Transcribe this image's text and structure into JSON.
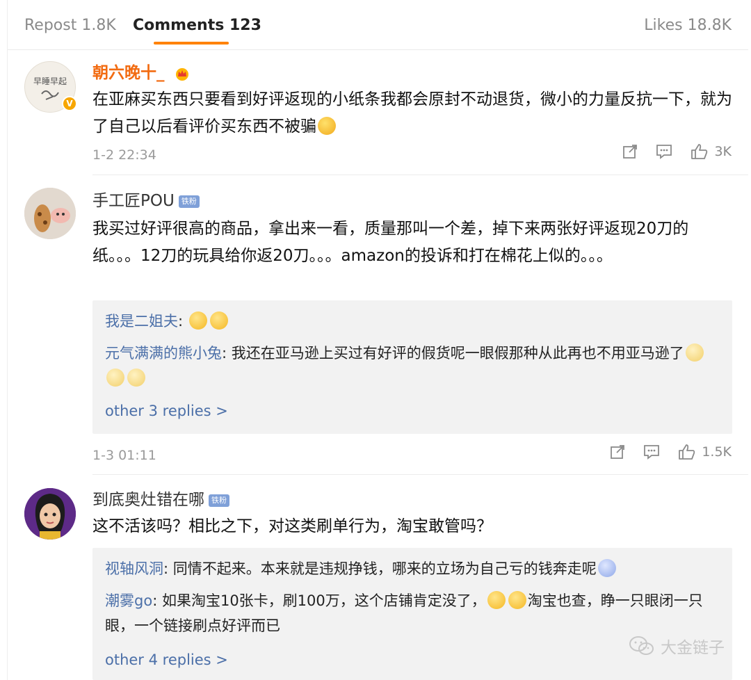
{
  "tabs": {
    "repost": "Repost 1.8K",
    "comments": "Comments 123",
    "likes": "Likes 18.8K"
  },
  "comments": [
    {
      "username": "朝六晚十_",
      "text": "在亚麻买东西只要看到好评返现的小纸条我都会原封不动退货，微小的力量反抗一下，就为了自己以后看评价买东西不被骗",
      "time": "1-2 22:34",
      "likes": "3K",
      "avatar_text": "早睡早起",
      "verified_badge": "V"
    },
    {
      "username": "手工匠POU",
      "fan_badge": "铁粉",
      "text": "我买过好评很高的商品，拿出来一看，质量那叫一个差，掉下来两张好评返现20刀的纸。。。12刀的玩具给你返20刀。。。amazon的投诉和打在棉花上似的。。。",
      "replies": [
        {
          "name": "我是二姐夫",
          "text": ""
        },
        {
          "name": "元气满满的熊小兔",
          "text": "我还在亚马逊上买过有好评的假货呢一眼假那种从此再也不用亚马逊了"
        }
      ],
      "more_replies": "other 3 replies >",
      "time": "1-3 01:11",
      "likes": "1.5K"
    },
    {
      "username": "到底奥灶错在哪",
      "fan_badge": "铁粉",
      "text": "这不活该吗？相比之下，对这类刷单行为，淘宝敢管吗？",
      "replies": [
        {
          "name": "视轴风洞",
          "text": "同情不起来。本来就是违规挣钱，哪来的立场为自己亏的钱奔走呢"
        },
        {
          "name": "潮雾go",
          "text_a": "如果淘宝10张卡，刷100万，这个店铺肯定没了，",
          "text_b": "淘宝也查，睁一只眼闭一只眼，一个链接刷点好评而已"
        }
      ],
      "more_replies": "other 4 replies >"
    }
  ],
  "watermark": "大金链子",
  "colors": {
    "accent": "#ff8200",
    "reply_name": "#4b6fa8",
    "vip_name": "#f26b11"
  }
}
